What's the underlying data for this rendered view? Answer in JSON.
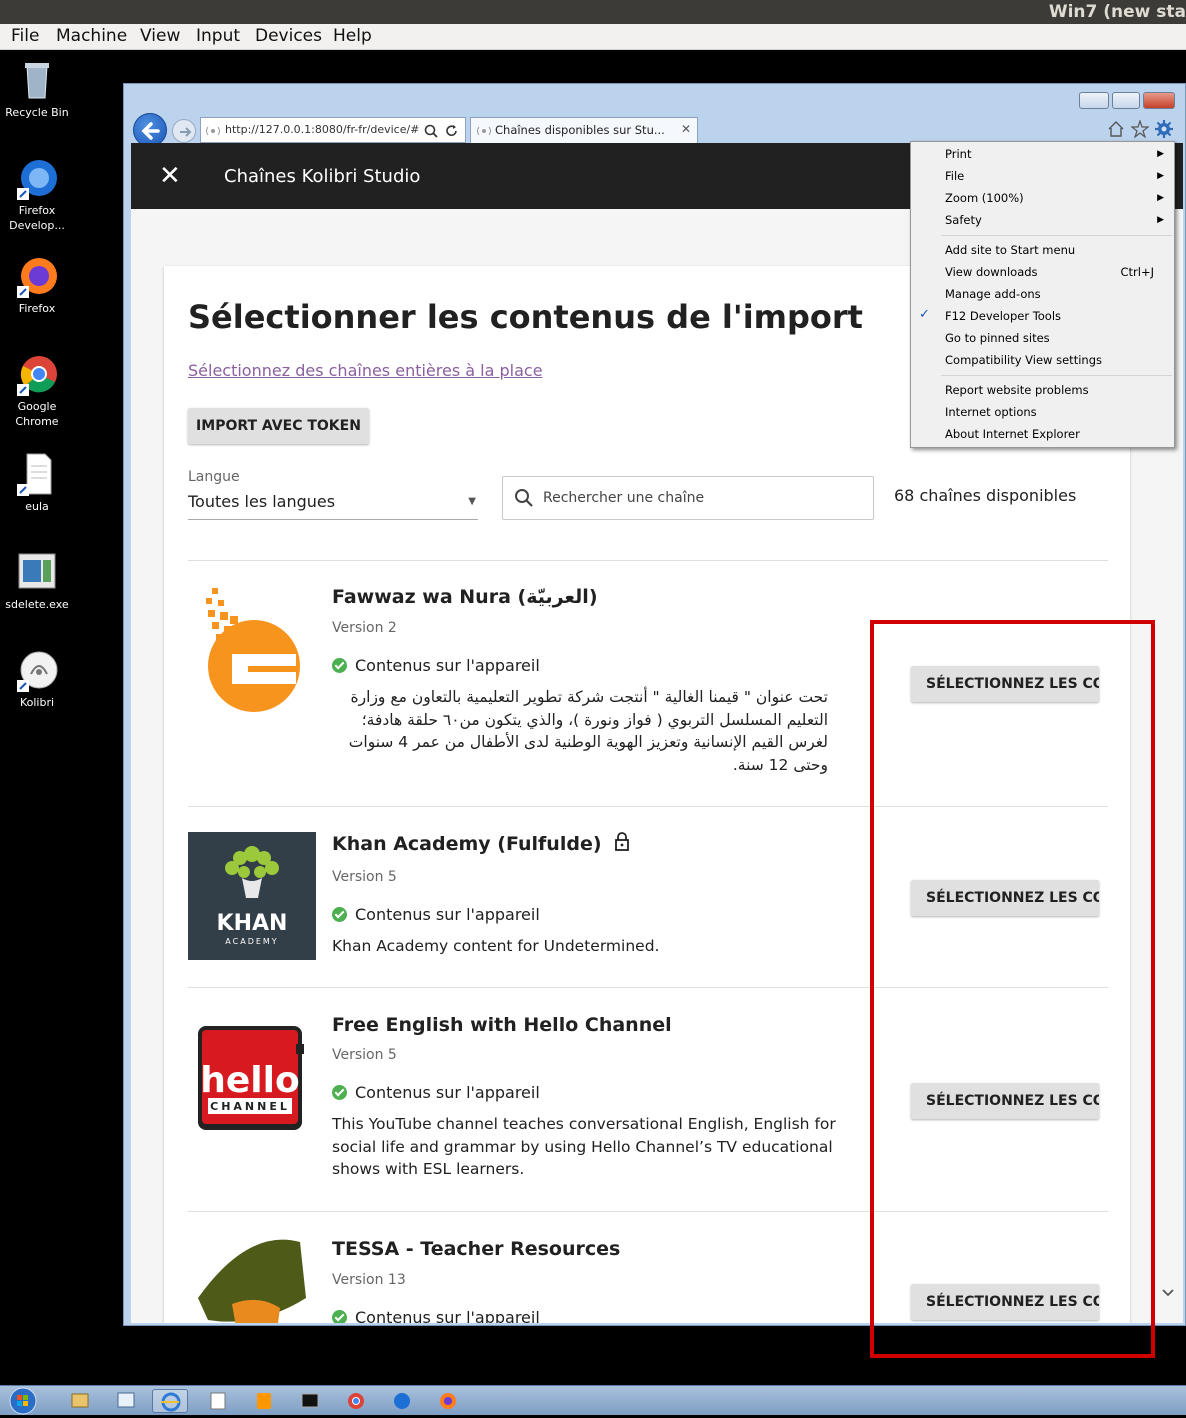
{
  "vm": {
    "title": "Win7 (new sta",
    "menus": [
      "File",
      "Machine",
      "View",
      "Input",
      "Devices",
      "Help"
    ]
  },
  "desktop": {
    "icons": [
      {
        "label": "Recycle Bin"
      },
      {
        "label": "Firefox Develop..."
      },
      {
        "label": "Firefox"
      },
      {
        "label": "Google Chrome"
      },
      {
        "label": "eula"
      },
      {
        "label": "sdelete.exe"
      },
      {
        "label": "Kolibri"
      }
    ]
  },
  "browser": {
    "address": "http://127.0.0.1:8080/fr-fr/device/#",
    "tab_title": "Chaînes disponibles sur Stu...",
    "tab_close": "✕"
  },
  "app": {
    "close": "✕",
    "title": "Chaînes Kolibri Studio"
  },
  "main": {
    "page_title": "Sélectionner les contenus de l'import",
    "whole_channels_link": "Sélectionnez des chaînes entières à la place",
    "token_button": "IMPORT AVEC TOKEN",
    "language_label": "Langue",
    "language_value": "Toutes les langues",
    "search_placeholder": "Rechercher une chaîne",
    "count": "68 chaînes disponibles"
  },
  "channels": [
    {
      "title": "Fawwaz wa Nura (العربيّة)",
      "version": "Version 2",
      "status": "Contenus sur l'appareil",
      "description": "تحت عنوان \" قيمنا الغالية \" أنتجت شركة تطوير التعليمية بالتعاون مع وزارة التعليم المسلسل التربوي ( فواز ونورة )، والذي يتكون من٦٠ حلقة هادفة؛ لغرس القيم الإنسانية وتعزيز الهوية الوطنية لدى الأطفال من عمر 4 سنوات وحتى 12 سنة.",
      "button": "SÉLECTIONNEZ LES CONTENUS"
    },
    {
      "title": "Khan Academy (Fulfulde)",
      "version": "Version 5",
      "status": "Contenus sur l'appareil",
      "description": "Khan Academy content for Undetermined.",
      "button": "SÉLECTIONNEZ LES CONTENUS",
      "logo_text": "KHAN",
      "logo_sub": "ACADEMY"
    },
    {
      "title": "Free English with Hello Channel",
      "version": "Version 5",
      "status": "Contenus sur l'appareil",
      "description": "This YouTube channel teaches conversational English, English for social life and grammar by using Hello Channel’s TV educational shows with ESL learners.",
      "button": "SÉLECTIONNEZ LES CONTENUS",
      "logo_text": "hello",
      "logo_sub": "CHANNEL"
    },
    {
      "title": "TESSA - Teacher Resources",
      "version": "Version 13",
      "status": "Contenus sur l'appareil",
      "button": "SÉLECTIONNEZ LES CONTENUS"
    }
  ],
  "tools_menu": {
    "items": [
      {
        "label": "Print",
        "submenu": true
      },
      {
        "label": "File",
        "submenu": true
      },
      {
        "label": "Zoom (100%)",
        "submenu": true
      },
      {
        "label": "Safety",
        "submenu": true
      },
      {
        "label": "Add site to Start menu"
      },
      {
        "label": "View downloads",
        "shortcut": "Ctrl+J"
      },
      {
        "label": "Manage add-ons"
      },
      {
        "label": "F12 Developer Tools",
        "checked": true
      },
      {
        "label": "Go to pinned sites"
      },
      {
        "label": "Compatibility View settings"
      },
      {
        "label": "Report website problems"
      },
      {
        "label": "Internet options"
      },
      {
        "label": "About Internet Explorer"
      }
    ],
    "check_mark": "✓",
    "submenu_arrow": "▶"
  },
  "colors": {
    "highlight": "#d00000",
    "app_bar": "#212121",
    "link": "#8b5fa0",
    "success": "#4caf50"
  }
}
